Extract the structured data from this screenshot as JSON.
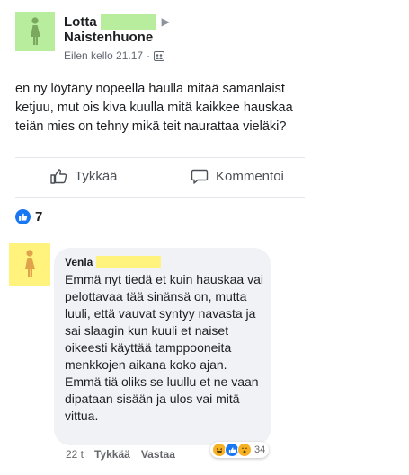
{
  "post": {
    "author": "Lotta",
    "group": "Naistenhuone",
    "timestamp": "Eilen kello 21.17",
    "separator": "·",
    "text": "en ny löytäny nopeella haulla mitää samanlaist ketjuu, mut ois kiva kuulla mitä kaikkee hauskaa teiän mies on tehny mikä teit naurattaa vieläki?",
    "like_label": "Tykkää",
    "comment_label": "Kommentoi",
    "reaction_count": "7"
  },
  "comment": {
    "author": "Venla",
    "text": "Emmä nyt tiedä et kuin hauskaa vai pelottavaa tää sinänsä on, mutta luuli, että vauvat syntyy navasta ja sai slaagin kun kuuli et naiset oikeesti käyttää tamppooneita menkkojen aikana koko ajan. Emmä tiä oliks se luullu et ne vaan dipataan sisään ja ulos vai mitä vittua.",
    "time": "22 t",
    "like_label": "Tykkää",
    "reply_label": "Vastaa",
    "reaction_count": "34",
    "reaction_icons": [
      "haha-icon",
      "like-icon",
      "wow-icon"
    ]
  },
  "colors": {
    "avatar_green": "#b7ed9c",
    "avatar_yellow": "#fff37e",
    "like_blue": "#1877f2",
    "bubble_gray": "#f0f2f5"
  }
}
